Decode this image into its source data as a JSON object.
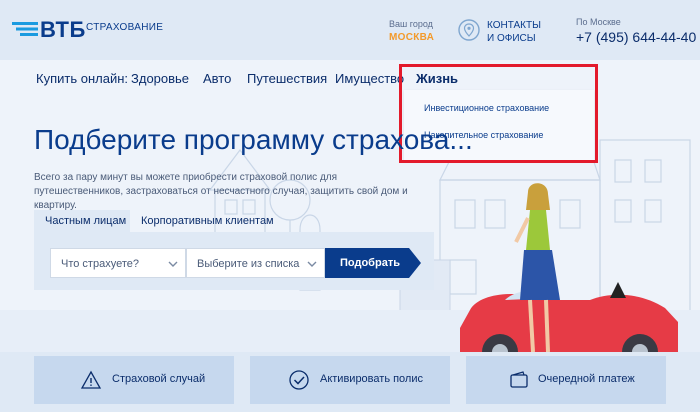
{
  "header": {
    "logo_text": "ВТБ",
    "logo_sub": "СТРАХОВАНИЕ",
    "city_label": "Ваш город",
    "city_value": "МОСКВА",
    "contacts_line1": "КОНТАКТЫ",
    "contacts_line2": "И ОФИСЫ",
    "phone_caption": "По Москве",
    "phone": "+7 (495) 644-44-40"
  },
  "nav": {
    "label": "Купить онлайн:",
    "items": [
      "Здоровье",
      "Авто",
      "Путешествия",
      "Имущество",
      "Жизнь"
    ]
  },
  "dropdown": {
    "items": [
      "Инвестиционное страхование",
      "Накопительное страхование"
    ]
  },
  "hero": {
    "title": "Подберите программу страхова...",
    "desc": "Всего за пару минут вы можете приобрести страховой полис для путешественников, застраховаться от несчастного случая, защитить свой дом и квартиру."
  },
  "tabs": [
    "Частным лицам",
    "Корпоративным клиентам"
  ],
  "form": {
    "select1": "Что страхуете?",
    "select2": "Выберите из списка",
    "button": "Подобрать"
  },
  "cards": [
    "Страховой случай",
    "Активировать полис",
    "Очередной платеж"
  ],
  "colors": {
    "brand": "#0a3c8c",
    "accent": "#f39a2b",
    "highlight": "#e31a2b"
  }
}
